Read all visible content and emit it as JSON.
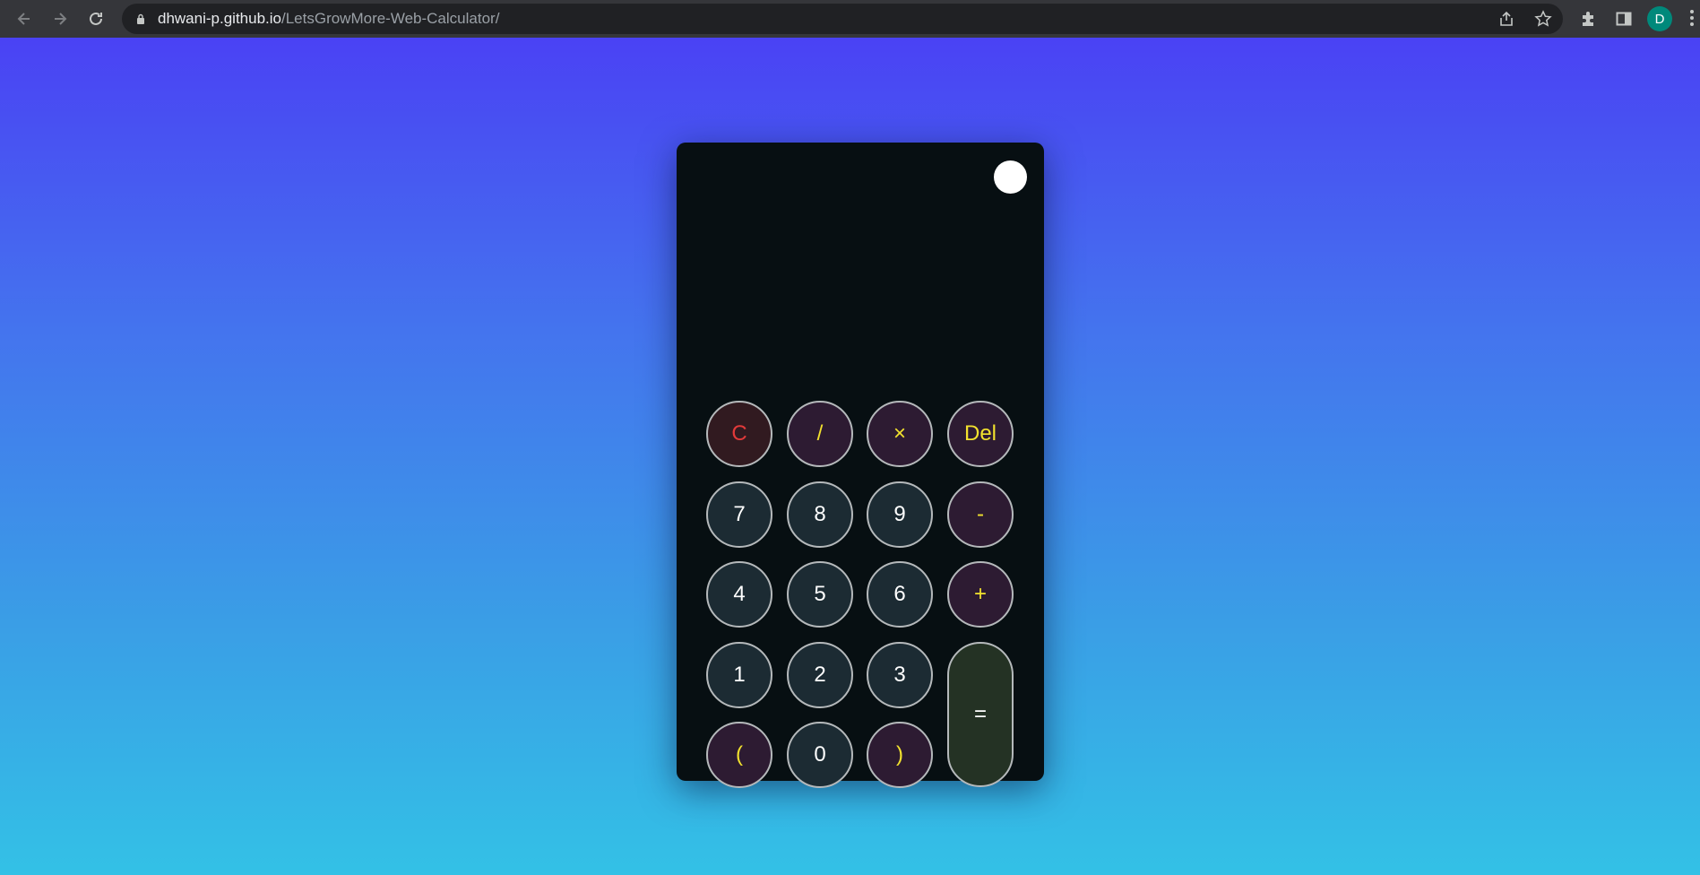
{
  "browser": {
    "url_host": "dhwani-p.github.io",
    "url_path": "/LetsGrowMore-Web-Calculator/",
    "profile_initial": "D",
    "icons": [
      "back-icon",
      "forward-icon",
      "reload-icon",
      "lock-icon",
      "share-icon",
      "star-icon",
      "extensions-icon",
      "side-panel-icon",
      "menu-icon"
    ]
  },
  "calculator": {
    "display": "",
    "keys": {
      "clear": "C",
      "divide": "/",
      "multiply": "×",
      "delete": "Del",
      "seven": "7",
      "eight": "8",
      "nine": "9",
      "minus": "-",
      "four": "4",
      "five": "5",
      "six": "6",
      "plus": "+",
      "one": "1",
      "two": "2",
      "three": "3",
      "equals": "=",
      "open_paren": "(",
      "zero": "0",
      "close_paren": ")"
    }
  },
  "colors": {
    "gradient_top": "#4a42f4",
    "gradient_bottom": "#33c1e6",
    "calculator_bg": "#070f12",
    "number_key": "#1c2b33",
    "operator_key": "#2d1b32",
    "operator_text": "#f2e22e",
    "clear_text": "#e23a3a",
    "equals_key": "#243224"
  }
}
